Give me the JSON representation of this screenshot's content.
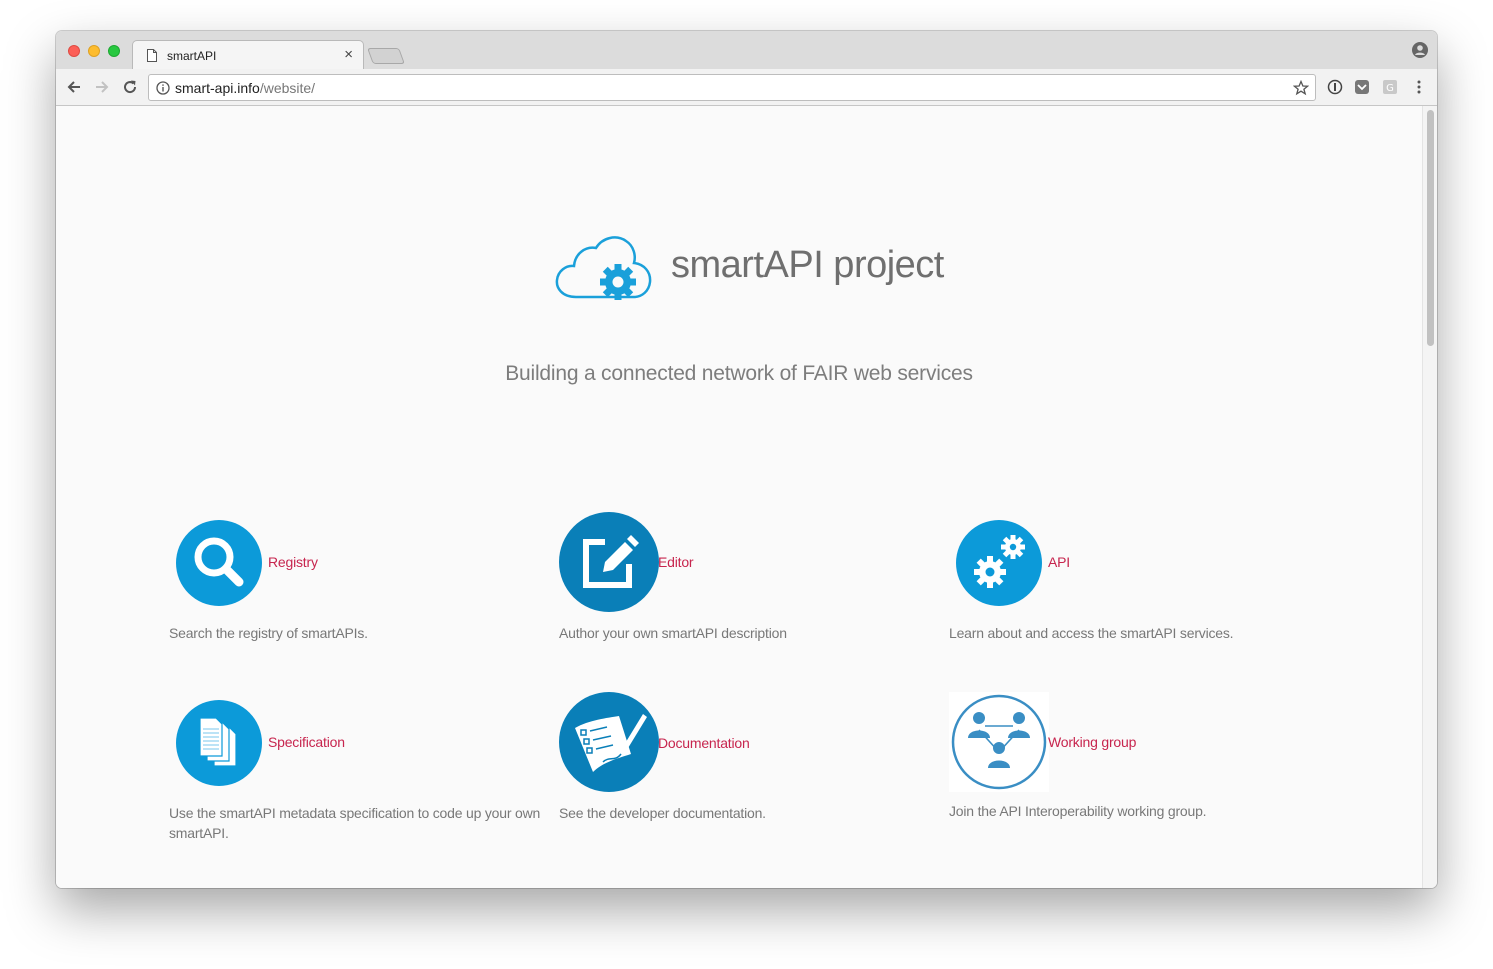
{
  "browser": {
    "tab_title": "smartAPI",
    "url_host": "smart-api.info",
    "url_path": "/website/",
    "colors": {
      "titlebar": "#dcdcdc",
      "toolbar": "#f2f2f2"
    }
  },
  "hero": {
    "title": "smartAPI project",
    "tagline": "Building a connected network of FAIR web services",
    "logo_icon": "cloud-gear-icon"
  },
  "features": [
    {
      "label": "Registry",
      "description": "Search the registry of smartAPIs.",
      "icon": "magnifier-icon"
    },
    {
      "label": "Editor",
      "description": "Author your own smartAPI description",
      "icon": "edit-icon"
    },
    {
      "label": "API",
      "description": "Learn about and access the smartAPI services.",
      "icon": "gears-icon"
    },
    {
      "label": "Specification",
      "description": "Use the smartAPI metadata specification to code up your own smartAPI.",
      "icon": "documents-icon"
    },
    {
      "label": "Documentation",
      "description": "See the developer documentation.",
      "icon": "signed-document-icon"
    },
    {
      "label": "Working group",
      "description": "Join the API Interoperability working group.",
      "icon": "people-network-icon"
    }
  ],
  "colors": {
    "accent_blue": "#0c97d8",
    "dark_blue": "#0a7fb8",
    "link": "#c7254e",
    "text": "#787878"
  }
}
